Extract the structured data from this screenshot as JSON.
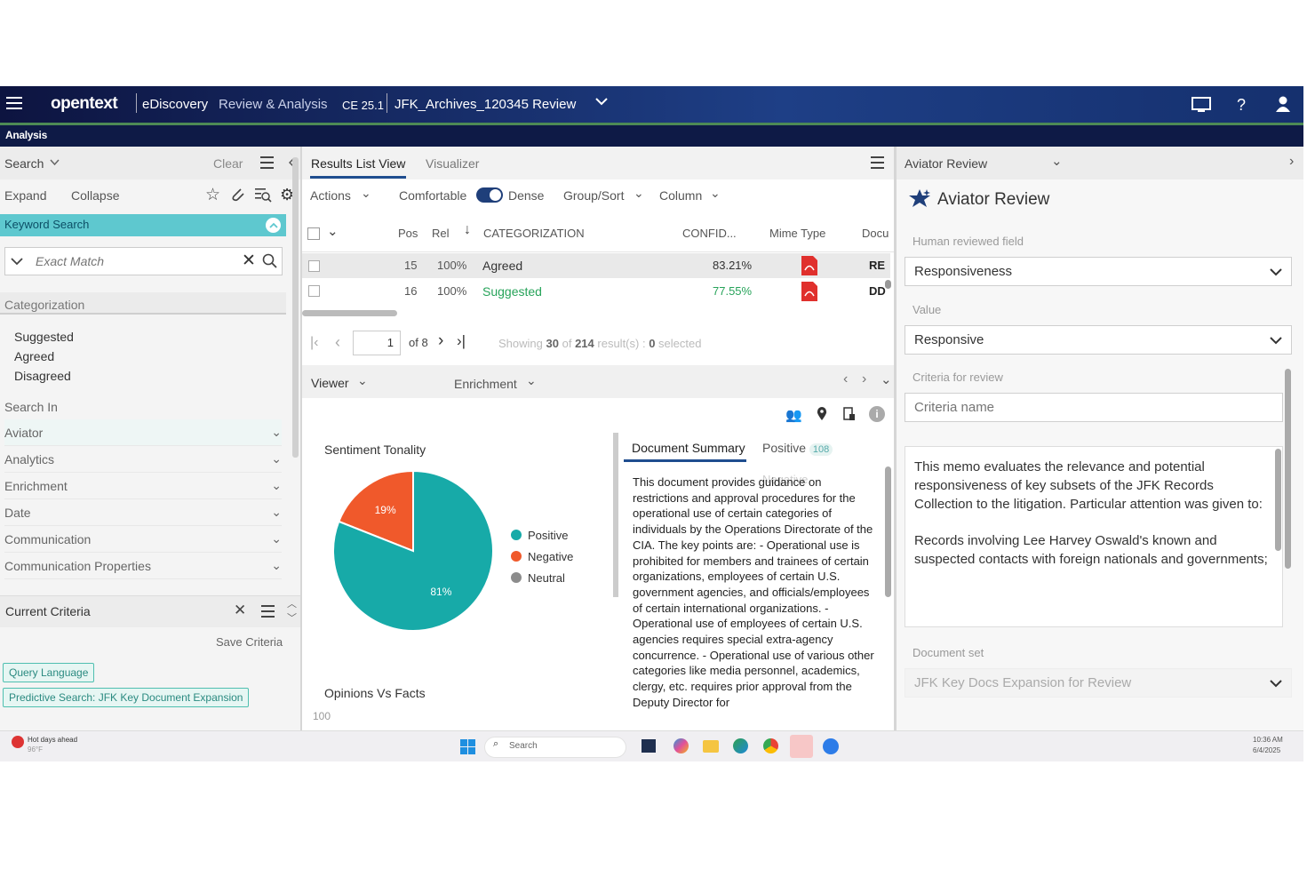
{
  "topbar": {
    "brand": "opentext",
    "product": "eDiscovery",
    "product_sub": "Review & Analysis",
    "version": "CE 25.1",
    "project": "JFK_Archives_120345 Review"
  },
  "subbar": {
    "title": "Analysis"
  },
  "search": {
    "title": "Search",
    "clear": "Clear",
    "expand": "Expand",
    "collapse": "Collapse",
    "keyword_title": "Keyword Search",
    "match_placeholder": "Exact Match",
    "categorization_title": "Categorization",
    "categories": [
      "Suggested",
      "Agreed",
      "Disagreed"
    ],
    "search_in": "Search In",
    "facets": [
      "Aviator",
      "Analytics",
      "Enrichment",
      "Date",
      "Communication",
      "Communication Properties"
    ],
    "current_criteria": "Current Criteria",
    "save_criteria": "Save Criteria",
    "chips": [
      "Query Language",
      "Predictive Search: JFK Key Document Expansion"
    ]
  },
  "results": {
    "tab_list": "Results List View",
    "tab_visualizer": "Visualizer",
    "actions": "Actions",
    "comfortable": "Comfortable",
    "dense": "Dense",
    "group_sort": "Group/Sort",
    "column": "Column",
    "columns": [
      "Pos",
      "Rel",
      "CATEGORIZATION",
      "CONFID...",
      "Mime Type",
      "Docu"
    ],
    "rows": [
      {
        "pos": "15",
        "rel": "100%",
        "cat": "Agreed",
        "conf": "83.21%",
        "doc": "RE"
      },
      {
        "pos": "16",
        "rel": "100%",
        "cat": "Suggested",
        "conf": "77.55%",
        "doc": "DD"
      }
    ],
    "page": "1",
    "of_pages": "of 8",
    "showing_pre": "Showing",
    "showing_n": "30",
    "showing_of": "of",
    "showing_total": "214",
    "showing_mid": "result(s) :",
    "showing_sel": "0",
    "showing_post": "selected"
  },
  "viewer": {
    "viewer": "Viewer",
    "enrichment": "Enrichment",
    "sentiment_title": "Sentiment Tonality",
    "opinions_title": "Opinions Vs Facts",
    "opinions_axis": "100",
    "doc_summary_tab": "Document Summary",
    "positive_tab": "Positive",
    "positive_count": "108",
    "negative_overlap": "Negative",
    "summary": "This document provides guidance on restrictions and approval procedures for the operational use of certain categories of individuals by the Operations Directorate of the CIA. The key points are: - Operational use is prohibited for members and trainees of certain organizations, employees of certain U.S. government agencies, and officials/employees of certain international organizations. - Operational use of employees of certain U.S. agencies requires special extra-agency concurrence. - Operational use of various other categories like media personnel, academics, clergy, etc. requires prior approval from the Deputy Director for"
  },
  "chart_data": {
    "type": "pie",
    "title": "Sentiment Tonality",
    "labels": [
      "Positive",
      "Negative",
      "Neutral"
    ],
    "values": [
      81,
      19,
      0
    ],
    "colors": [
      "#17aaa8",
      "#f0592b",
      "#8c8c8c"
    ],
    "data_labels": [
      "81%",
      "19%",
      ""
    ],
    "legend": "right"
  },
  "aviator": {
    "header": "Aviator Review",
    "title": "Aviator Review",
    "human_label": "Human reviewed field",
    "human_value": "Responsiveness",
    "value_label": "Value",
    "value": "Responsive",
    "criteria_label": "Criteria for review",
    "criteria_placeholder": "Criteria name",
    "text1": "This memo evaluates the relevance and potential responsiveness of key subsets of the JFK Records Collection to the litigation. Particular attention was given to:",
    "text2": "Records involving Lee Harvey Oswald's known and suspected contacts with foreign nationals and governments;",
    "docset_label": "Document set",
    "docset_value": "JFK Key Docs Expansion for Review"
  },
  "taskbar": {
    "weather": "Hot days ahead",
    "temp": "96°F",
    "search": "Search",
    "time": "10:36 AM",
    "date": "6/4/2025"
  }
}
